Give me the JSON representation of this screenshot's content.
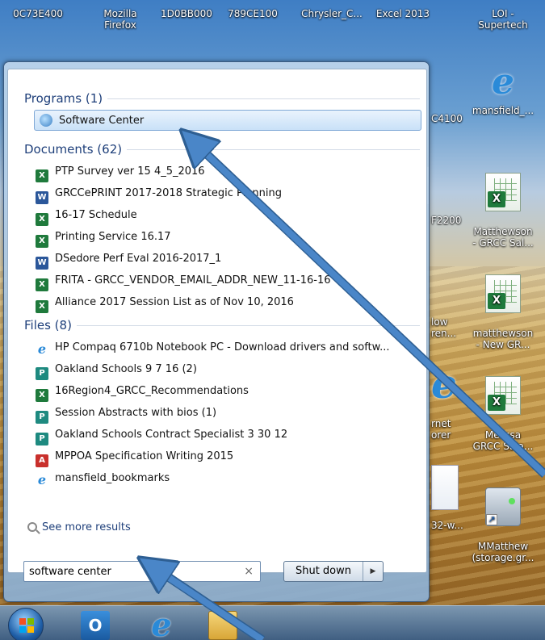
{
  "desktop": {
    "top_labels": [
      "0C73E400",
      "Mozilla\nFirefox",
      "1D0BB000",
      "789CE100",
      "Chrysler_C...",
      "Excel 2013",
      "LOI -\nSupertech"
    ],
    "icons": [
      {
        "label": "mansfield_...",
        "icon": "ie-icon"
      },
      {
        "label": "Matthewson\n- GRCC Sal...",
        "icon": "excel-file-icon"
      },
      {
        "label": "matthewson\n- New GR...",
        "icon": "excel-file-icon"
      },
      {
        "label": "Melissa\nGRCC Sala...",
        "icon": "excel-file-icon"
      },
      {
        "label": "MMatthew\n(storage.gr...",
        "icon": "network-drive-icon"
      }
    ],
    "partial_labels": [
      "C4100",
      "F2200",
      "low\nren...",
      "rnet\norer",
      "32-w..."
    ]
  },
  "start_menu": {
    "groups": [
      {
        "header": "Programs (1)",
        "items": [
          {
            "label": "Software Center",
            "icon": "software-center-icon",
            "selected": true
          }
        ]
      },
      {
        "header": "Documents (62)",
        "items": [
          {
            "label": "PTP Survey ver 15 4_5_2016",
            "icon": "excel-icon"
          },
          {
            "label": "GRCCePRINT 2017-2018 Strategic Planning",
            "icon": "word-icon"
          },
          {
            "label": "16-17 Schedule",
            "icon": "excel-icon"
          },
          {
            "label": "Printing Service 16.17",
            "icon": "excel-icon"
          },
          {
            "label": "DSedore Perf Eval 2016-2017_1",
            "icon": "word-icon"
          },
          {
            "label": "FRITA - GRCC_VENDOR_EMAIL_ADDR_NEW_11-16-16",
            "icon": "excel-icon"
          },
          {
            "label": "Alliance 2017 Session List as of Nov 10, 2016",
            "icon": "excel-icon"
          }
        ]
      },
      {
        "header": "Files (8)",
        "items": [
          {
            "label": "HP Compaq 6710b Notebook PC - Download drivers and softw...",
            "icon": "ie-icon"
          },
          {
            "label": "Oakland Schools 9 7 16 (2)",
            "icon": "publisher-icon"
          },
          {
            "label": "16Region4_GRCC_Recommendations",
            "icon": "excel-icon"
          },
          {
            "label": "Session Abstracts with bios (1)",
            "icon": "publisher-icon"
          },
          {
            "label": "Oakland Schools Contract Specialist 3 30 12",
            "icon": "publisher-icon"
          },
          {
            "label": "MPPOA Specification Writing 2015",
            "icon": "pdf-icon"
          },
          {
            "label": "mansfield_bookmarks",
            "icon": "ie-icon"
          }
        ]
      }
    ],
    "see_more": "See more results",
    "search_value": "software center",
    "clear_glyph": "×",
    "shutdown_label": "Shut down",
    "shutdown_arrow": "▶"
  },
  "taskbar": {
    "pinned": [
      {
        "name": "outlook",
        "icon": "outlook-icon",
        "glyph": "O"
      },
      {
        "name": "internet-explorer",
        "icon": "ie-icon",
        "glyph": "e"
      },
      {
        "name": "windows-explorer",
        "icon": "folder-icon"
      }
    ]
  },
  "colors": {
    "arrow": "#4a86c8",
    "group_header": "#1e3f7a",
    "selection": "#c9e1f8"
  }
}
